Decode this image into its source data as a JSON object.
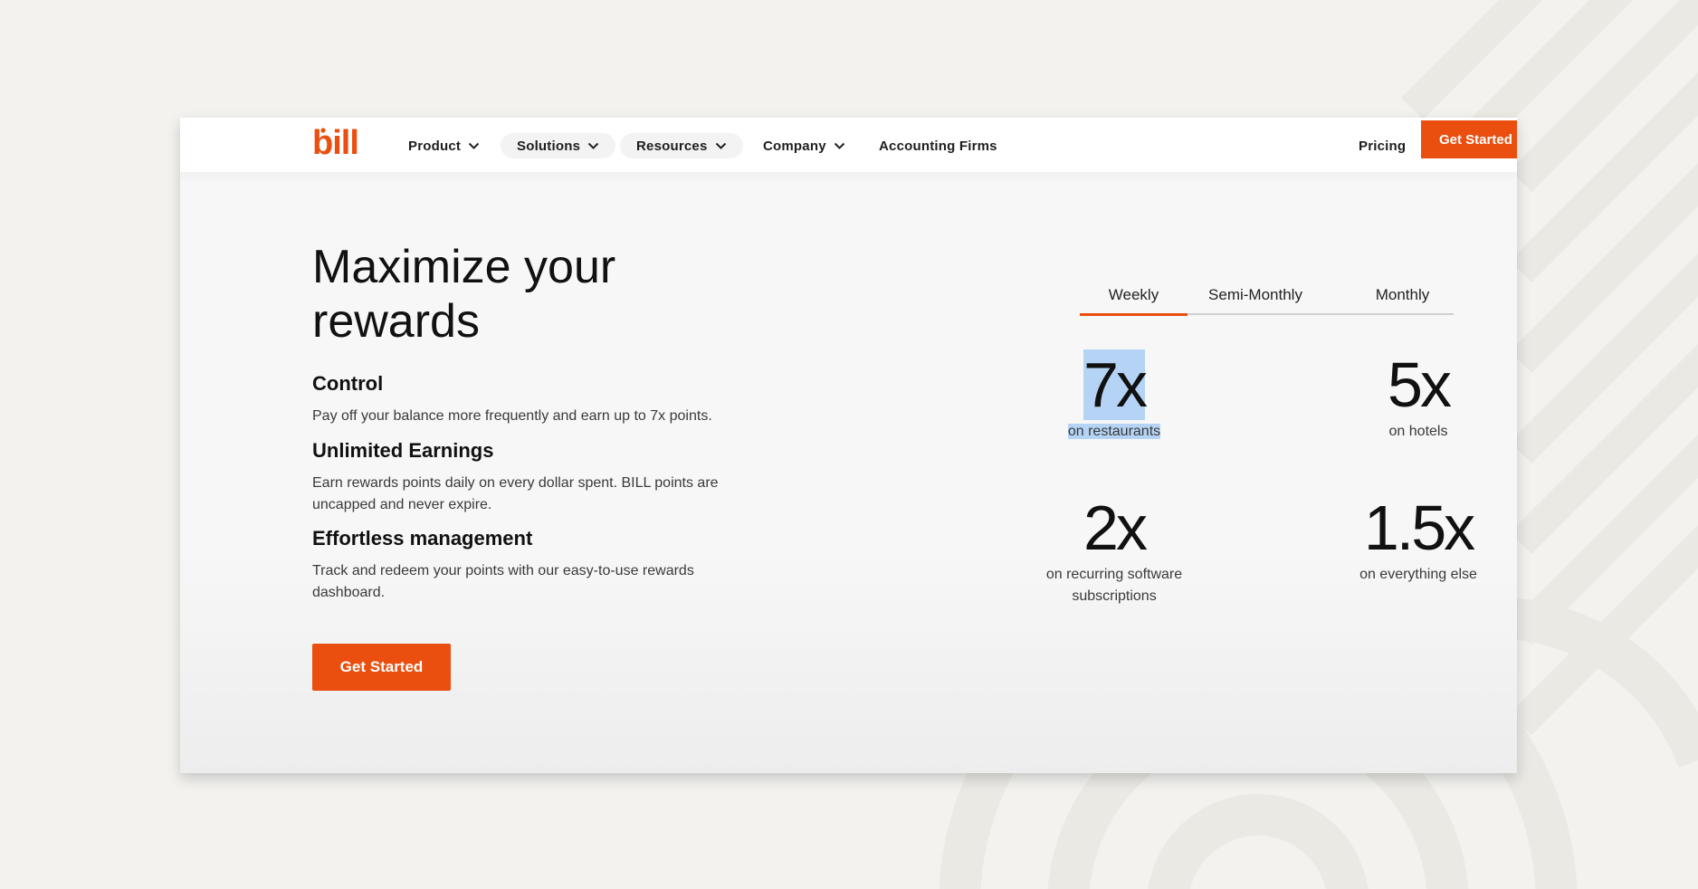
{
  "nav": {
    "logo_text": "bill",
    "items": [
      {
        "label": "Product"
      },
      {
        "label": "Solutions"
      },
      {
        "label": "Resources"
      },
      {
        "label": "Company"
      },
      {
        "label": "Accounting Firms"
      }
    ],
    "pricing": "Pricing",
    "cta": "Get Started"
  },
  "hero": {
    "title": "Maximize your rewards",
    "features": [
      {
        "heading": "Control",
        "text": "Pay off your balance more frequently and earn up to 7x points."
      },
      {
        "heading": "Unlimited Earnings",
        "text": "Earn rewards points daily on every dollar spent. BILL points are uncapped and never expire."
      },
      {
        "heading": "Effortless management",
        "text": "Track and redeem your points with our easy-to-use rewards dashboard."
      }
    ],
    "cta": "Get Started"
  },
  "rewards": {
    "tabs": [
      {
        "label": "Weekly",
        "active": true
      },
      {
        "label": "Semi-Monthly",
        "active": false
      },
      {
        "label": "Monthly",
        "active": false
      }
    ],
    "stats": [
      {
        "value": "7x",
        "label": "on restaurants"
      },
      {
        "value": "5x",
        "label": "on hotels"
      },
      {
        "value": "2x",
        "label": "on recurring software subscriptions"
      },
      {
        "value": "1.5x",
        "label": "on everything else"
      }
    ]
  },
  "colors": {
    "brand_orange": "#ea4f10",
    "selection_highlight": "#b5d4f5",
    "page_background": "#f3f2ef"
  }
}
